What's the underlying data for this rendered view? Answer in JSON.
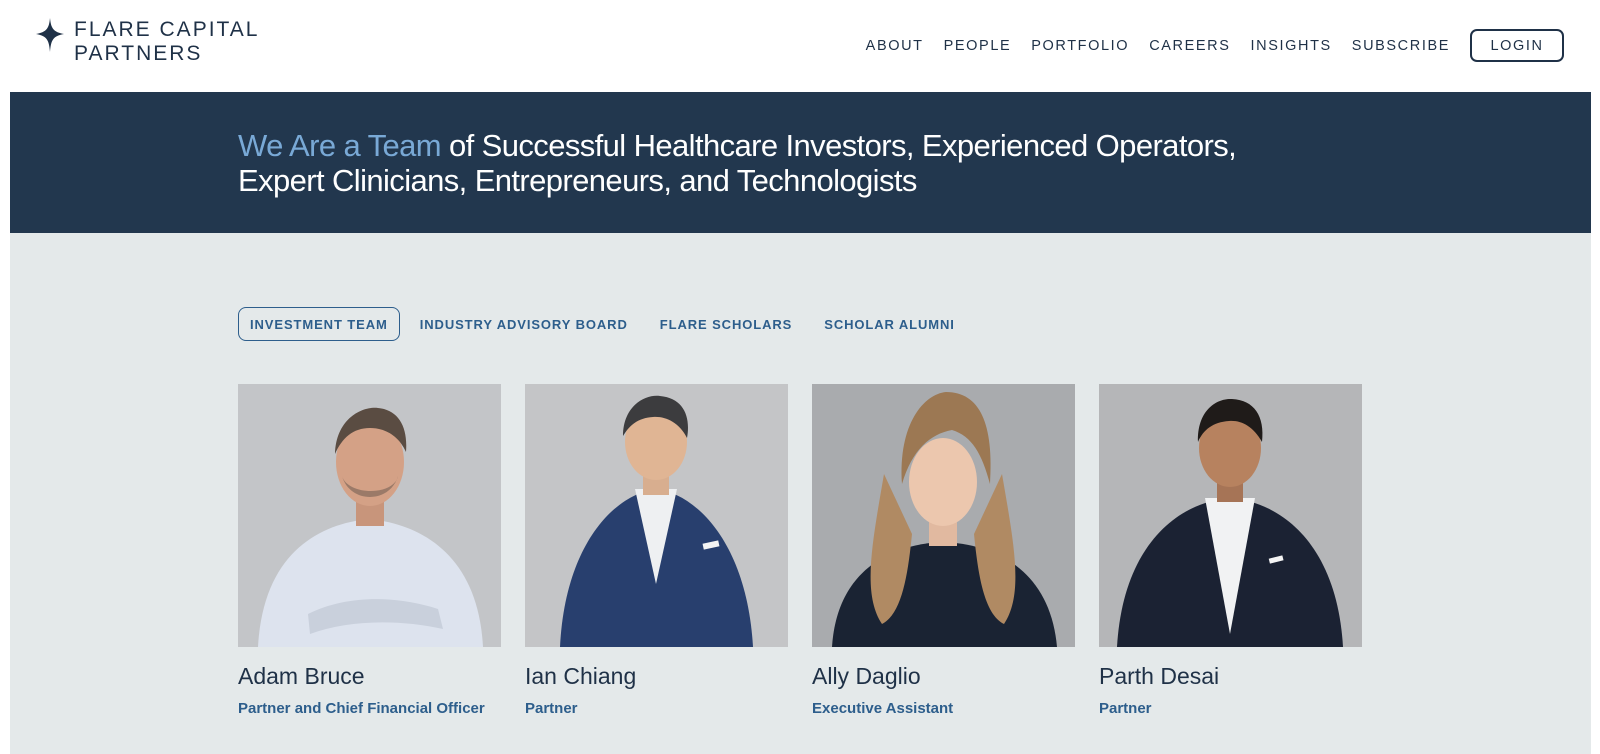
{
  "logo": {
    "line1": "FLARE CAPITAL",
    "line2": "PARTNERS",
    "icon": "four-point-star-icon"
  },
  "nav": {
    "items": [
      {
        "label": "ABOUT"
      },
      {
        "label": "PEOPLE"
      },
      {
        "label": "PORTFOLIO"
      },
      {
        "label": "CAREERS"
      },
      {
        "label": "INSIGHTS"
      },
      {
        "label": "SUBSCRIBE"
      }
    ],
    "login_label": "LOGIN"
  },
  "hero": {
    "accent": "We Are a Team",
    "rest_line1": " of Successful Healthcare Investors, Experienced Operators,",
    "rest_line2": "Expert Clinicians, Entrepreneurs, and Technologists"
  },
  "tabs": [
    {
      "label": "INVESTMENT TEAM",
      "active": true
    },
    {
      "label": "INDUSTRY ADVISORY BOARD",
      "active": false
    },
    {
      "label": "FLARE SCHOLARS",
      "active": false
    },
    {
      "label": "SCHOLAR ALUMNI",
      "active": false
    }
  ],
  "team": [
    {
      "name": "Adam Bruce",
      "role": "Partner and Chief Financial Officer"
    },
    {
      "name": "Ian Chiang",
      "role": "Partner"
    },
    {
      "name": "Ally Daglio",
      "role": "Executive Assistant"
    },
    {
      "name": "Parth Desai",
      "role": "Partner"
    }
  ],
  "colors": {
    "navy": "#22374e",
    "accent_blue": "#79a9d6",
    "link_blue": "#2d5e8c",
    "content_bg": "#e4e9ea"
  }
}
